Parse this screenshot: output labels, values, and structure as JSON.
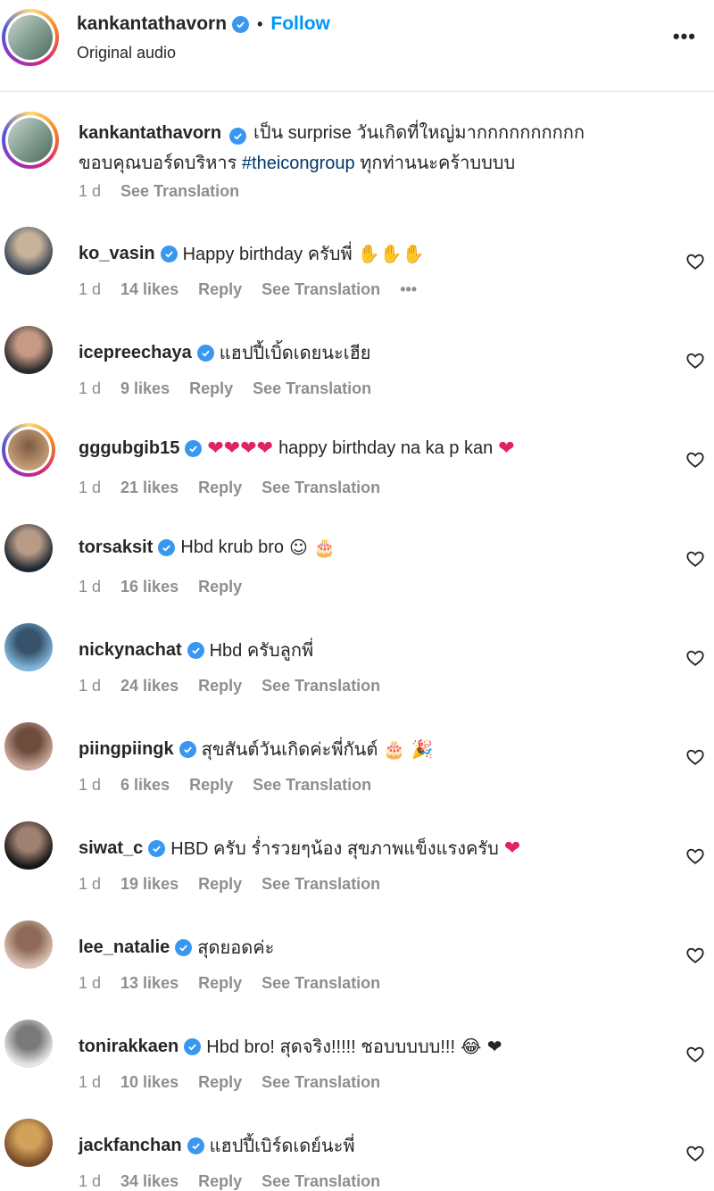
{
  "header": {
    "username": "kankantathavorn",
    "follow_label": "Follow",
    "separator": "•",
    "audio": "Original audio",
    "more": "•••"
  },
  "caption": {
    "username": "kankantathavorn",
    "text_part1": "เป็น surprise วันเกิดที่ใหญ่มากกกกกกกกกก",
    "text_part2": "ขอบคุณบอร์ดบริหาร ",
    "hashtag": "#theicongroup",
    "text_part3": " ทุกท่านนะคร้าบบบบ",
    "time": "1 d",
    "see_translation": "See Translation"
  },
  "comments": [
    {
      "username": "ko_vasin",
      "text": "Happy birthday ครับพี่",
      "emoji": "✋✋✋",
      "time": "1 d",
      "likes": "14 likes",
      "reply": "Reply",
      "see_translation": "See Translation",
      "more": "•••"
    },
    {
      "username": "icepreechaya",
      "text": "แฮปปี้เบิ้ดเดยนะเฮีย",
      "emoji": "",
      "time": "1 d",
      "likes": "9 likes",
      "reply": "Reply",
      "see_translation": "See Translation"
    },
    {
      "username": "gggubgib15",
      "text": "happy birthday na ka p kan",
      "emoji": "❤❤❤❤",
      "emoji_after": "❤",
      "time": "1 d",
      "likes": "21 likes",
      "reply": "Reply",
      "see_translation": "See Translation"
    },
    {
      "username": "torsaksit",
      "text": "Hbd krub bro",
      "emoji": "☺ 🎂",
      "time": "1 d",
      "likes": "16 likes",
      "reply": "Reply"
    },
    {
      "username": "nickynachat",
      "text": "Hbd ครับลูกพี่",
      "emoji": "",
      "time": "1 d",
      "likes": "24 likes",
      "reply": "Reply",
      "see_translation": "See Translation"
    },
    {
      "username": "piingpiingk",
      "text": "สุขสันต์วันเกิดค่ะพี่กันต์",
      "emoji": "🎂 🎉",
      "time": "1 d",
      "likes": "6 likes",
      "reply": "Reply",
      "see_translation": "See Translation"
    },
    {
      "username": "siwat_c",
      "text": "HBD ครับ ร่ำรวยๆน้อง สุขภาพแข็งแรงครับ",
      "emoji": "❤",
      "time": "1 d",
      "likes": "19 likes",
      "reply": "Reply",
      "see_translation": "See Translation"
    },
    {
      "username": "lee_natalie",
      "text": "สุดยอดค่ะ",
      "emoji": "",
      "time": "1 d",
      "likes": "13 likes",
      "reply": "Reply",
      "see_translation": "See Translation"
    },
    {
      "username": "tonirakkaen",
      "text": "Hbd bro! สุดจริง!!!!! ชอบบบบบ!!!",
      "emoji": "😂 ❤",
      "time": "1 d",
      "likes": "10 likes",
      "reply": "Reply",
      "see_translation": "See Translation"
    },
    {
      "username": "jackfanchan",
      "text": "แฮปปี้เบิร์ดเดย์นะพี่",
      "emoji": "",
      "time": "1 d",
      "likes": "34 likes",
      "reply": "Reply",
      "see_translation": "See Translation"
    }
  ],
  "colors": {
    "link_blue": "#0095f6",
    "hashtag": "#00376b",
    "verified": "#3897f0",
    "meta_grey": "#8e8e8e",
    "heart_red": "#e0245e"
  }
}
